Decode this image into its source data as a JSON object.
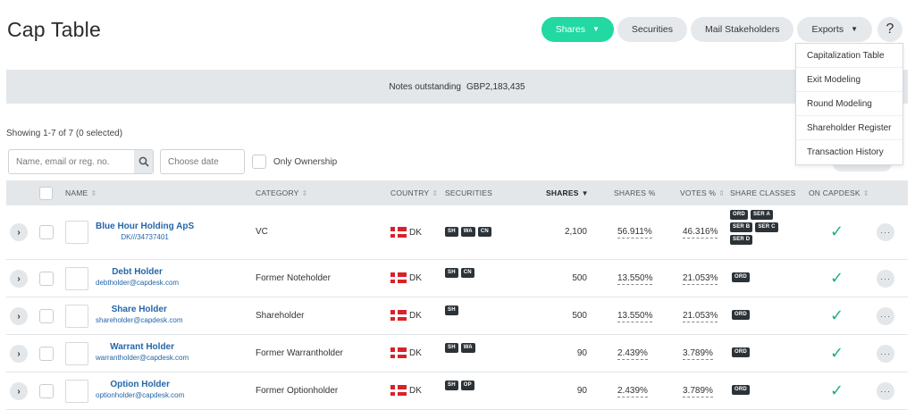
{
  "page": {
    "title": "Cap Table"
  },
  "toolbar": {
    "shares_label": "Shares",
    "securities_label": "Securities",
    "mail_label": "Mail Stakeholders",
    "exports_label": "Exports",
    "help_label": "?"
  },
  "exports_menu": [
    "Capitalization Table",
    "Exit Modeling",
    "Round Modeling",
    "Shareholder Register",
    "Transaction History"
  ],
  "notes": {
    "label": "Notes outstanding",
    "value": "GBP2,183,435"
  },
  "filters": {
    "showing": "Showing 1-7 of 7 (0 selected)",
    "search_placeholder": "Name, email or reg. no.",
    "date_placeholder": "Choose date",
    "only_ownership": "Only Ownership"
  },
  "table": {
    "headers": {
      "name": "NAME",
      "category": "CATEGORY",
      "country": "COUNTRY",
      "securities": "SECURITIES",
      "shares": "SHARES",
      "shares_pct": "SHARES %",
      "votes_pct": "VOTES %",
      "share_classes": "SHARE CLASSES",
      "on_capdesk": "ON CAPDESK"
    },
    "rows": [
      {
        "name": "Blue Hour Holding ApS",
        "sub": "DK///34737401",
        "category": "VC",
        "country": "DK",
        "securities": [
          "SH",
          "WA",
          "CN"
        ],
        "shares": "2,100",
        "shares_pct": "56.911%",
        "votes_pct": "46.316%",
        "classes": [
          "ORD",
          "SER A",
          "SER B",
          "SER C",
          "SER D"
        ]
      },
      {
        "name": "Debt Holder",
        "sub": "debtholder@capdesk.com",
        "category": "Former Noteholder",
        "country": "DK",
        "securities": [
          "SH",
          "CN"
        ],
        "shares": "500",
        "shares_pct": "13.550%",
        "votes_pct": "21.053%",
        "classes": [
          "ORD"
        ]
      },
      {
        "name": "Share Holder",
        "sub": "shareholder@capdesk.com",
        "category": "Shareholder",
        "country": "DK",
        "securities": [
          "SH"
        ],
        "shares": "500",
        "shares_pct": "13.550%",
        "votes_pct": "21.053%",
        "classes": [
          "ORD"
        ]
      },
      {
        "name": "Warrant Holder",
        "sub": "warrantholder@capdesk.com",
        "category": "Former Warrantholder",
        "country": "DK",
        "securities": [
          "SH",
          "WA"
        ],
        "shares": "90",
        "shares_pct": "2.439%",
        "votes_pct": "3.789%",
        "classes": [
          "ORD"
        ]
      },
      {
        "name": "Option Holder",
        "sub": "optionholder@capdesk.com",
        "category": "Former Optionholder",
        "country": "DK",
        "securities": [
          "SH",
          "OP"
        ],
        "shares": "90",
        "shares_pct": "2.439%",
        "votes_pct": "3.789%",
        "classes": [
          "ORD"
        ]
      }
    ]
  },
  "colors": {
    "accent": "#22d8a3",
    "link": "#2466a8",
    "check": "#22b07d",
    "badge": "#2c3338",
    "bar": "#e3e7ea"
  },
  "icons": {
    "search": "search-icon",
    "check": "check-icon",
    "more": "more-icon",
    "expand": "chevron-right-icon",
    "flag": "denmark-flag-icon"
  }
}
